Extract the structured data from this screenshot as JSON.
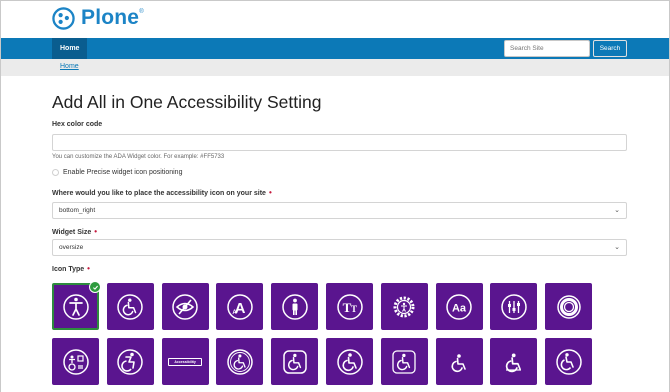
{
  "brand": {
    "name": "Plone",
    "mark": "®",
    "color": "#1c84c6"
  },
  "nav": {
    "home_label": "Home",
    "color": "#0c79b7"
  },
  "search": {
    "placeholder": "Search Site",
    "button_label": "Search"
  },
  "breadcrumb": {
    "home_label": "Home"
  },
  "page": {
    "title": "Add All in One Accessibility Setting"
  },
  "form": {
    "hex_color": {
      "label": "Hex color code",
      "value": "",
      "help": "You can customize the ADA Widget color. For example: #FF5733"
    },
    "precise_positioning": {
      "label": "Enable Precise widget icon positioning",
      "checked": false
    },
    "position": {
      "label": "Where would you like to place the accessibility icon on your site",
      "required": true,
      "value": "bottom_right"
    },
    "size": {
      "label": "Widget Size",
      "required": true,
      "value": "oversize"
    },
    "icon_type": {
      "label": "Icon Type",
      "required": true,
      "selected_index": 0,
      "tile_color": "#5a158f",
      "row1": [
        "accessibility-figure-circle-icon",
        "wheelchair-circle-icon",
        "low-vision-eye-icon",
        "text-size-a-icon",
        "standing-person-icon",
        "text-tt-icon",
        "gear-figure-icon",
        "aa-font-icon",
        "sliders-icon",
        "life-ring-icon"
      ],
      "row2": [
        "accessibility-tools-icon",
        "dynamic-wheelchair-icon",
        "accessibility-text-bar-icon",
        "wheelchair-circle-outline-icon",
        "wheelchair-square-icon",
        "wheelchair-plain-icon",
        "wheelchair-alt-icon",
        "wheelchair-thin-icon",
        "wheelchair-bold-icon",
        "wheelchair-push-icon"
      ],
      "bar_text": "Accessibility"
    }
  }
}
